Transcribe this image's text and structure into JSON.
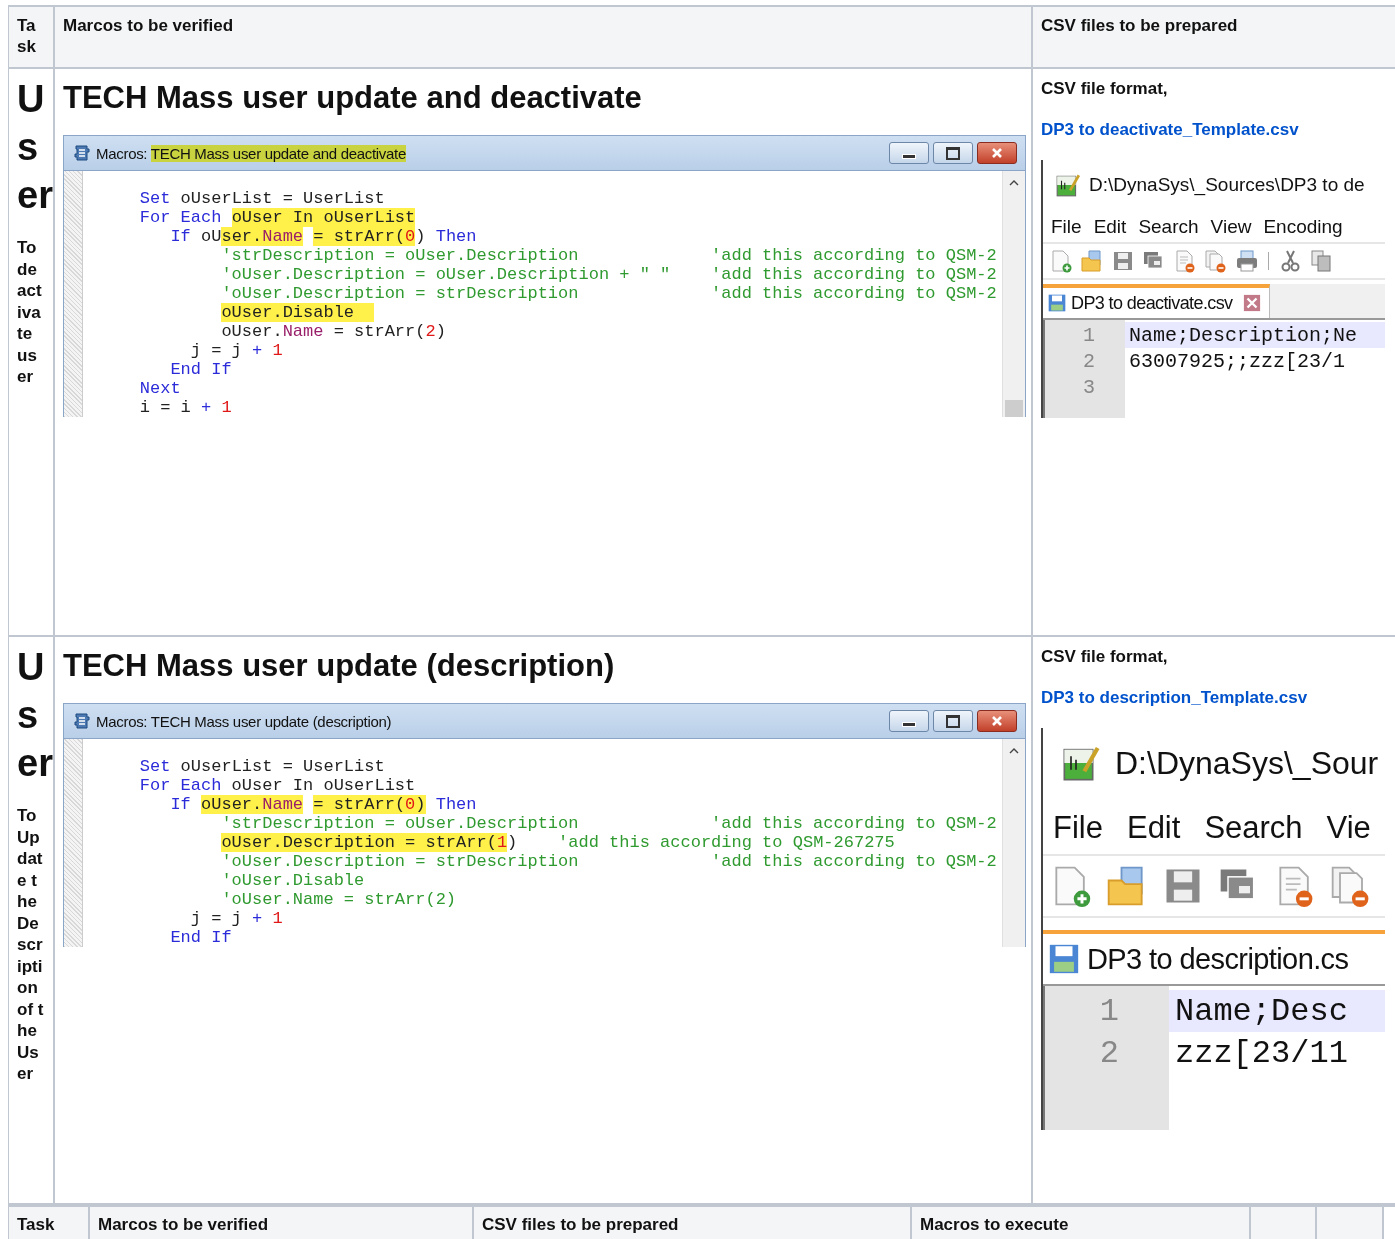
{
  "table": {
    "columns": [
      "Task",
      "Marcos to be verified",
      "CSV files to be prepared"
    ],
    "rows": [
      {
        "task_title": "User",
        "task_description": "To deactivate user",
        "heading": "TECH Mass user update and deactivate",
        "macro_window": {
          "title_prefix": "Macros:",
          "title_name": "TECH Mass user update and deactivate",
          "title_highlighted": true,
          "scroll_thumb": true,
          "lines": [
            {
              "tokens": [
                {
                  "text": "    Set",
                  "kind": "keyword",
                  "highlight": false
                },
                {
                  "text": " oUserList = UserList",
                  "kind": "plain",
                  "highlight": false
                }
              ]
            },
            {
              "tokens": [
                {
                  "text": "    For Each",
                  "kind": "keyword",
                  "highlight": false
                },
                {
                  "text": " oUser In oUserList",
                  "kind": "plain",
                  "highlight": true
                }
              ]
            },
            {
              "tokens": [
                {
                  "text": "       If",
                  "kind": "keyword",
                  "highlight": false
                },
                {
                  "text": " oU",
                  "kind": "plain",
                  "highlight": false
                },
                {
                  "text": "ser.",
                  "kind": "plain",
                  "highlight": true
                },
                {
                  "text": "Name",
                  "kind": "property",
                  "highlight": true
                },
                {
                  "text": " = strArr(",
                  "kind": "plain",
                  "highlight": true
                },
                {
                  "text": "0",
                  "kind": "number",
                  "highlight": true
                },
                {
                  "text": ")",
                  "kind": "plain",
                  "highlight": false
                },
                {
                  "text": " Then",
                  "kind": "keyword",
                  "highlight": false
                }
              ]
            },
            {
              "tokens": [
                {
                  "text": "            'strDescription = oUser.Description             'add this according to QSM-2",
                  "kind": "comment",
                  "highlight": false
                }
              ]
            },
            {
              "tokens": [
                {
                  "text": "            'oUser.Description = oUser.Description + \" \"    'add this according to QSM-2",
                  "kind": "comment",
                  "highlight": false
                }
              ]
            },
            {
              "tokens": [
                {
                  "text": "            'oUser.Description = strDescription             'add this according to QSM-2",
                  "kind": "comment",
                  "highlight": false
                }
              ]
            },
            {
              "tokens": [
                {
                  "text": "            oUser.Disable  ",
                  "kind": "plain",
                  "highlight": true
                }
              ]
            },
            {
              "tokens": [
                {
                  "text": "            oUser.",
                  "kind": "plain",
                  "highlight": false
                },
                {
                  "text": "Name",
                  "kind": "property",
                  "highlight": false
                },
                {
                  "text": " = strArr(",
                  "kind": "plain",
                  "highlight": false
                },
                {
                  "text": "2",
                  "kind": "number",
                  "highlight": false
                },
                {
                  "text": ")",
                  "kind": "plain",
                  "highlight": false
                }
              ]
            },
            {
              "tokens": [
                {
                  "text": "         j = j ",
                  "kind": "plain",
                  "highlight": false
                },
                {
                  "text": "+",
                  "kind": "keyword",
                  "highlight": false
                },
                {
                  "text": " 1",
                  "kind": "number",
                  "highlight": false
                }
              ]
            },
            {
              "tokens": [
                {
                  "text": "       End If",
                  "kind": "keyword",
                  "highlight": false
                }
              ]
            },
            {
              "tokens": [
                {
                  "text": "    Next",
                  "kind": "keyword",
                  "highlight": false
                }
              ]
            },
            {
              "tokens": [
                {
                  "text": "    i = i ",
                  "kind": "plain",
                  "highlight": false
                },
                {
                  "text": "+",
                  "kind": "keyword",
                  "highlight": false
                },
                {
                  "text": " 1",
                  "kind": "number",
                  "highlight": false
                }
              ]
            }
          ]
        },
        "csv_label": "CSV file format,",
        "csv_link": "DP3 to deactivate_Template.csv",
        "editor": {
          "kind": "normal",
          "title": "D:\\DynaSys\\_Sources\\DP3 to de",
          "menu": [
            "File",
            "Edit",
            "Search",
            "View",
            "Encoding"
          ],
          "tab": "DP3 to deactivate.csv",
          "tab_close": true,
          "lines": [
            {
              "number": "1",
              "text": "Name;Description;Ne",
              "current": true
            },
            {
              "number": "2",
              "text": "63007925;;zzz[23/1",
              "current": false
            },
            {
              "number": "3",
              "current": false
            }
          ]
        }
      },
      {
        "task_title": "User",
        "task_description": "To Update the Description of the User",
        "heading": "TECH Mass user update (description)",
        "macro_window": {
          "title_prefix": "Macros:",
          "title_name": "TECH Mass user update (description)",
          "title_highlighted": false,
          "scroll_thumb": false,
          "lines": [
            {
              "tokens": [
                {
                  "text": "    Set",
                  "kind": "keyword",
                  "highlight": false
                },
                {
                  "text": " oUserList = UserList",
                  "kind": "plain",
                  "highlight": false
                }
              ]
            },
            {
              "tokens": [
                {
                  "text": "    For Each",
                  "kind": "keyword",
                  "highlight": false
                },
                {
                  "text": " oUser In oUserList",
                  "kind": "plain",
                  "highlight": false
                }
              ]
            },
            {
              "tokens": [
                {
                  "text": "       If",
                  "kind": "keyword",
                  "highlight": false
                },
                {
                  "text": " oUser.",
                  "kind": "plain",
                  "highlight": true
                },
                {
                  "text": "Name",
                  "kind": "property",
                  "highlight": true
                },
                {
                  "text": " = strArr(",
                  "kind": "plain",
                  "highlight": true
                },
                {
                  "text": "0",
                  "kind": "number",
                  "highlight": true
                },
                {
                  "text": ")",
                  "kind": "plain",
                  "highlight": true
                },
                {
                  "text": " Then",
                  "kind": "keyword",
                  "highlight": false
                }
              ]
            },
            {
              "tokens": [
                {
                  "text": "            'strDescription = oUser.Description             'add this according to QSM-2",
                  "kind": "comment",
                  "highlight": false
                }
              ]
            },
            {
              "tokens": [
                {
                  "text": "            oUser.Description = strArr(",
                  "kind": "plain",
                  "highlight": true
                },
                {
                  "text": "1",
                  "kind": "number",
                  "highlight": true
                },
                {
                  "text": ")",
                  "kind": "plain",
                  "highlight": false
                },
                {
                  "text": "    'add this according to QSM-267275",
                  "kind": "comment",
                  "highlight": false
                }
              ]
            },
            {
              "tokens": [
                {
                  "text": "            'oUser.Description = strDescription             'add this according to QSM-2",
                  "kind": "comment",
                  "highlight": false
                }
              ]
            },
            {
              "tokens": [
                {
                  "text": "            'oUser.Disable",
                  "kind": "comment",
                  "highlight": false
                }
              ]
            },
            {
              "tokens": [
                {
                  "text": "            'oUser.Name = strArr(2)",
                  "kind": "comment",
                  "highlight": false
                }
              ]
            },
            {
              "tokens": [
                {
                  "text": "         j = j ",
                  "kind": "plain",
                  "highlight": false
                },
                {
                  "text": "+",
                  "kind": "keyword",
                  "highlight": false
                },
                {
                  "text": " 1",
                  "kind": "number",
                  "highlight": false
                }
              ]
            },
            {
              "tokens": [
                {
                  "text": "       End If",
                  "kind": "keyword",
                  "highlight": false
                }
              ]
            }
          ]
        },
        "csv_label": "CSV file format,",
        "csv_link": "DP3 to description_Template.csv",
        "editor": {
          "kind": "large",
          "title": "D:\\DynaSys\\_Sour",
          "menu": [
            "File",
            "Edit",
            "Search",
            "Vie"
          ],
          "tab": "DP3 to description.cs",
          "tab_close": false,
          "lines": [
            {
              "number": "1",
              "text": "Name;Desc",
              "current": true
            },
            {
              "number": "2",
              "text": "zzz[23/11",
              "current": false
            }
          ]
        }
      }
    ]
  },
  "table_2": {
    "columns": [
      "Task",
      "Marcos to be verified",
      "CSV files to be prepared",
      "Macros to execute"
    ]
  }
}
